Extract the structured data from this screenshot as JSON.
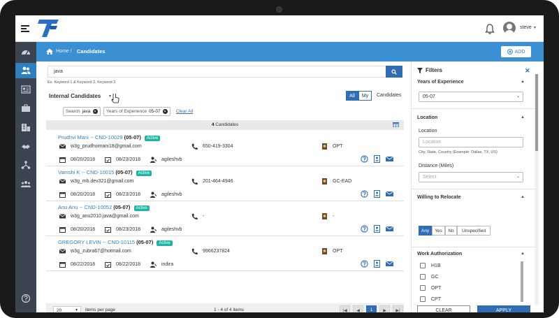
{
  "header": {
    "user_name": "steve"
  },
  "breadcrumb": {
    "home": "Home",
    "separator": "/",
    "current": "Candidates",
    "add_label": "ADD"
  },
  "search": {
    "value": "java",
    "hint": "Ex: Keyword 1 & Keyword 2, Keyword 3"
  },
  "candidates_header": {
    "title": "Internal Candidates",
    "seg_all": "All",
    "seg_my": "My",
    "label": "Candidates"
  },
  "chips": [
    {
      "label": "Search",
      "value": "java"
    },
    {
      "label": "Years of Experience",
      "value": "05-07"
    }
  ],
  "clear_all": "Clear All",
  "count": {
    "number": "4",
    "label": "Candidates"
  },
  "candidates": [
    {
      "name": "Prudhvi Mani -- CND-10029",
      "exp": "(05-07)",
      "status": "Active",
      "email": "w3g_prudhvimani18@gmail.com",
      "phone": "650-419-3304",
      "visa": "OPT",
      "created": "08/20/2018",
      "updated": "08/23/2018",
      "owner": "agileshvb"
    },
    {
      "name": "Vamshi K -- CND-10015",
      "exp": "(05-07)",
      "status": "Active",
      "email": "w3g_mb.dev321@gmail.com",
      "phone": "201-464-4946",
      "visa": "GC-EAD",
      "created": "08/20/2018",
      "updated": "08/23/2018",
      "owner": "agileshvb"
    },
    {
      "name": "Anu Anu -- CND-10052",
      "exp": "(05-07)",
      "status": "Active",
      "email": "w3g_anu2010.java@gmail.com",
      "phone": "-",
      "visa": "-",
      "created": "08/20/2018",
      "updated": "08/23/2018",
      "owner": "agileshvb"
    },
    {
      "name": "GREGORY LEVIN -- CND-10115",
      "exp": "(05-07)",
      "status": "Active",
      "email": "w3g_zubra67@hotmail.com",
      "phone": "9966237824",
      "visa": "OPT",
      "created": "08/22/2018",
      "updated": "08/22/2018",
      "owner": "indira"
    }
  ],
  "pagination": {
    "per_page": "20",
    "per_page_label": "items per page",
    "range": "1 - 4 of 4 items",
    "first": "|◀",
    "prev": "◀",
    "current_page": "1",
    "next": "▶",
    "last": "▶|"
  },
  "filters": {
    "title": "Filters",
    "experience": {
      "heading": "Years of Experience",
      "value": "05-07"
    },
    "location": {
      "heading": "Location",
      "label": "Location",
      "placeholder": "Location",
      "hint": "City, State, Country (Example: Dallas, TX, US)",
      "distance_label": "Distance (Miles)",
      "distance_placeholder": "Select"
    },
    "relocate": {
      "heading": "Willing to Relocate",
      "options": [
        "Any",
        "Yes",
        "No",
        "Unspecified"
      ],
      "selected": "Any"
    },
    "work_auth": {
      "heading": "Work Authorization",
      "items": [
        "H1B",
        "GC",
        "OPT",
        "CPT"
      ]
    },
    "clear_label": "CLEAR",
    "apply_label": "APPLY"
  },
  "colors": {
    "primary": "#2f6db5",
    "breadcrumb_bg": "#3b8fd3",
    "sidebar_bg": "#3d4451",
    "active_badge": "#1fb5a4"
  },
  "icons": {
    "sidebar": [
      "dashboard-icon",
      "users-icon",
      "id-card-icon",
      "briefcase-icon",
      "building-icon",
      "handshake-icon",
      "hierarchy-icon",
      "group-icon",
      "help-icon"
    ]
  }
}
